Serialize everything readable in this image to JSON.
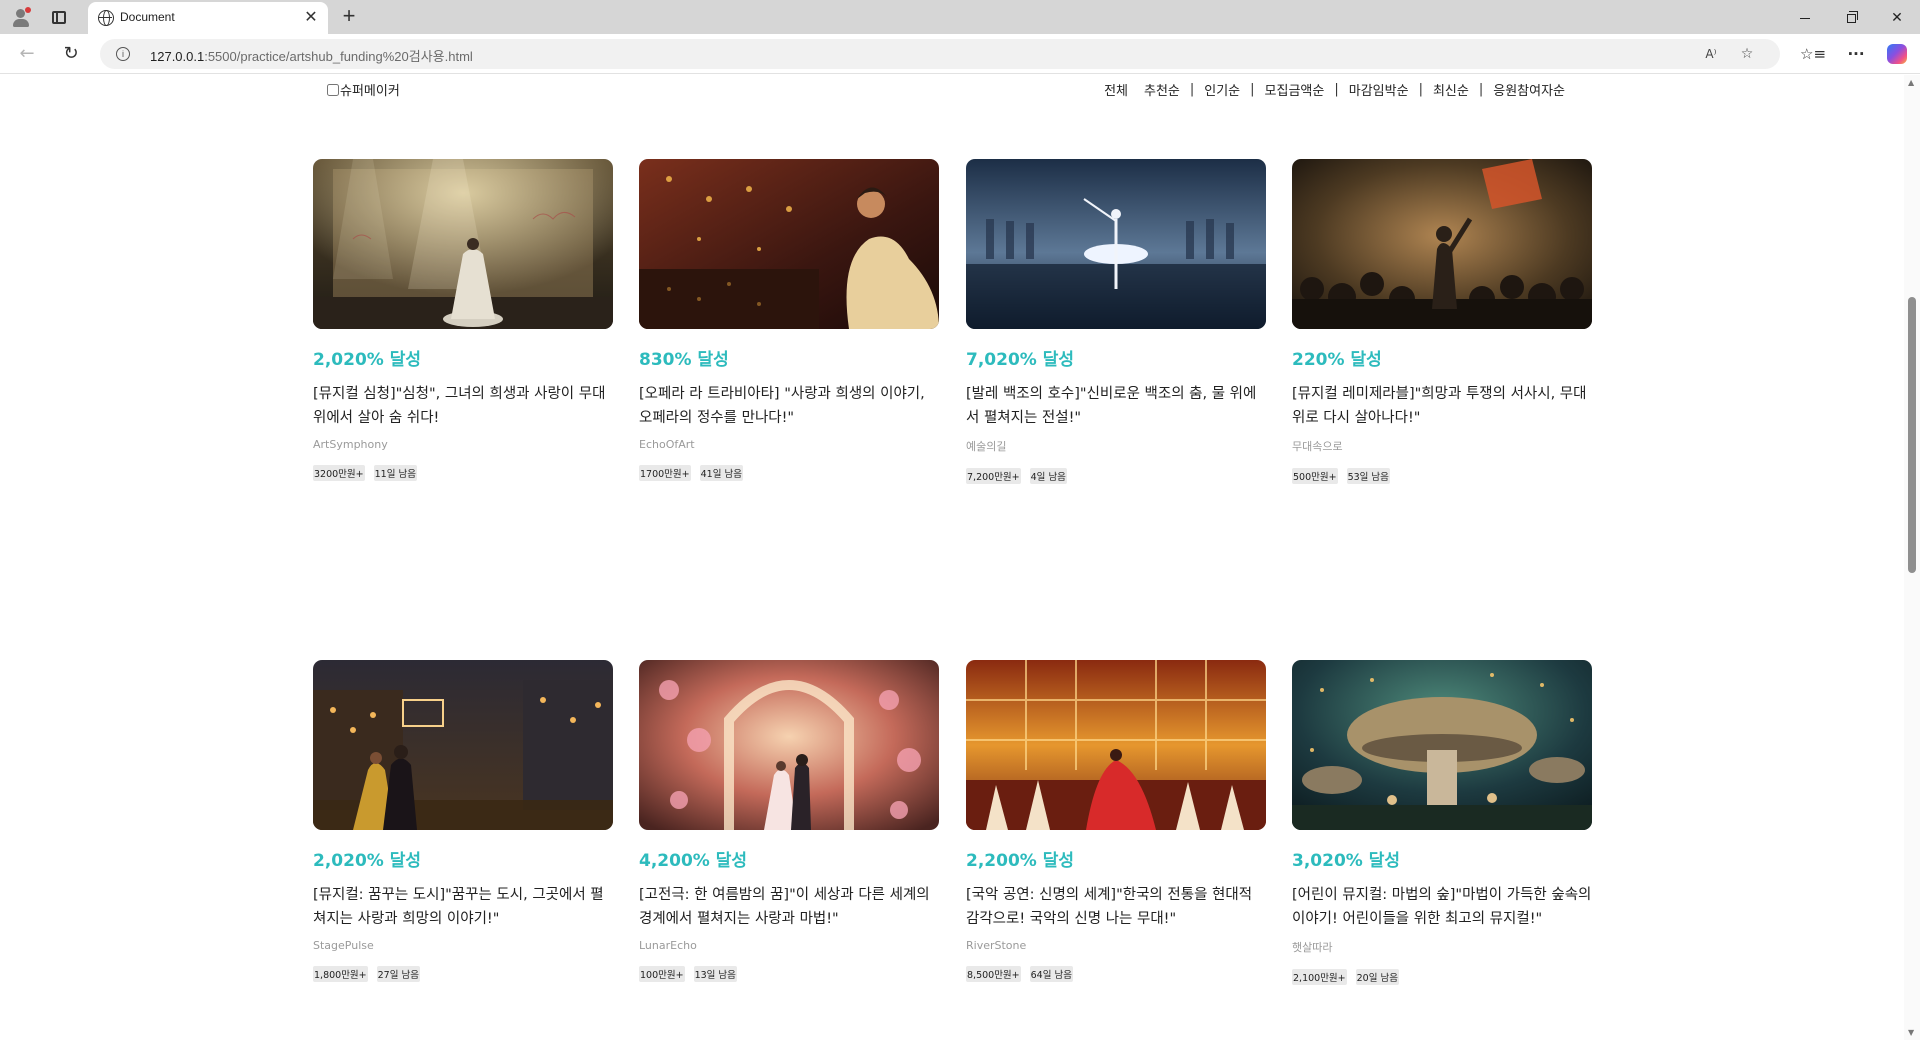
{
  "browser": {
    "tab_title": "Document",
    "url_host": "127.0.0.1",
    "url_rest": ":5500/practice/artshub_funding%20검사용.html"
  },
  "filter": {
    "super_maker_label": "슈퍼메이커",
    "sort_options": [
      "전체",
      "추천순",
      "인기순",
      "모집금액순",
      "마감임박순",
      "최신순",
      "응원참여자순"
    ]
  },
  "accent_color": "#2dbbbd",
  "projects": [
    {
      "rate": "2,020% 달성",
      "title": "[뮤지컬 심청]\"심청\", 그녀의 희생과 사랑이 무대 위에서 살아 숨 쉬다!",
      "creator": "ArtSymphony",
      "amount": "3200만원+",
      "days_left": "11일 남음",
      "image": "stage-scene-woman-in-hanbok"
    },
    {
      "rate": "830% 달성",
      "title": "[오페라 라 트라비아타] \"사랑과 희생의 이야기, 오페라의 정수를 만나다!\"",
      "creator": "EchoOfArt",
      "amount": "1700만원+",
      "days_left": "41일 남음",
      "image": "opera-house-soprano"
    },
    {
      "rate": "7,020% 달성",
      "title": "[발레 백조의 호수]\"신비로운 백조의 춤, 물 위에서 펼쳐지는 전설!\"",
      "creator": "예술의길",
      "amount": "7,200만원+",
      "days_left": "4일 남음",
      "image": "ballerina-on-water"
    },
    {
      "rate": "220% 달성",
      "title": "[뮤지컬 레미제라블]\"희망과 투쟁의 서사시, 무대 위로 다시 살아나다!\"",
      "creator": "무대속으로",
      "amount": "500만원+",
      "days_left": "53일 남음",
      "image": "barricade-crowd-scene"
    },
    {
      "rate": "2,020% 달성",
      "title": "[뮤지컬: 꿈꾸는 도시]\"꿈꾸는 도시, 그곳에서 펼쳐지는 사랑과 희망의 이야기!\"",
      "creator": "StagePulse",
      "amount": "1,800만원+",
      "days_left": "27일 남음",
      "image": "night-city-couple"
    },
    {
      "rate": "4,200% 달성",
      "title": "[고전극: 한 여름밤의 꿈]\"이 세상과 다른 세계의 경계에서 펼쳐지는 사랑과 마법!\"",
      "creator": "LunarEcho",
      "amount": "100만원+",
      "days_left": "13일 남음",
      "image": "floral-arch-couple"
    },
    {
      "rate": "2,200% 달성",
      "title": "[국악 공연: 신명의 세계]\"한국의 전통을 현대적 감각으로! 국악의 신명 나는 무대!\"",
      "creator": "RiverStone",
      "amount": "8,500만원+",
      "days_left": "64일 남음",
      "image": "traditional-dancers-red"
    },
    {
      "rate": "3,020% 달성",
      "title": "[어린이 뮤지컬: 마법의 숲]\"마법이 가득한 숲속의 이야기! 어린이들을 위한 최고의 뮤지컬!\"",
      "creator": "햇살따라",
      "amount": "2,100만원+",
      "days_left": "20일 남음",
      "image": "giant-mushroom-forest"
    }
  ]
}
